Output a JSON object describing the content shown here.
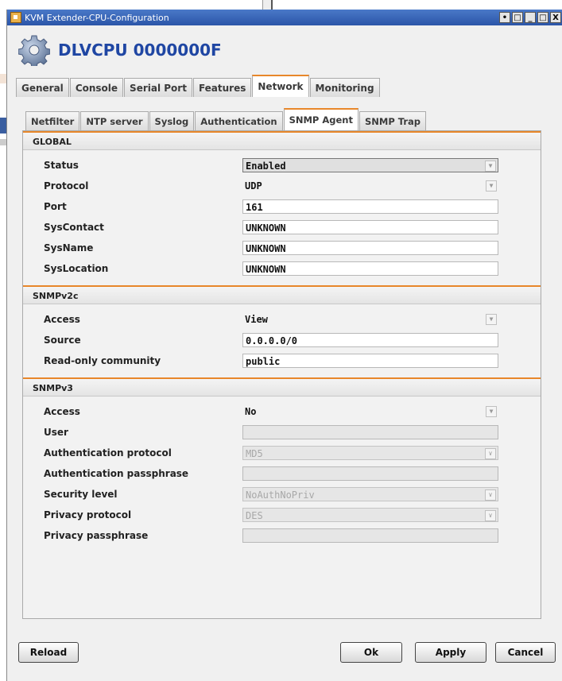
{
  "window": {
    "title": "KVM Extender-CPU-Configuration",
    "controls": [
      "•",
      "□",
      "_",
      "□",
      "X"
    ]
  },
  "header": {
    "device_title": "DLVCPU 0000000F"
  },
  "main_tabs": [
    {
      "label": "General",
      "active": false
    },
    {
      "label": "Console",
      "active": false
    },
    {
      "label": "Serial Port",
      "active": false
    },
    {
      "label": "Features",
      "active": false
    },
    {
      "label": "Network",
      "active": true
    },
    {
      "label": "Monitoring",
      "active": false
    }
  ],
  "sub_tabs": [
    {
      "label": "Netfilter",
      "active": false
    },
    {
      "label": "NTP server",
      "active": false
    },
    {
      "label": "Syslog",
      "active": false
    },
    {
      "label": "Authentication",
      "active": false
    },
    {
      "label": "SNMP Agent",
      "active": true
    },
    {
      "label": "SNMP Trap",
      "active": false
    }
  ],
  "global": {
    "heading": "GLOBAL",
    "status_label": "Status",
    "status_value": "Enabled",
    "protocol_label": "Protocol",
    "protocol_value": "UDP",
    "port_label": "Port",
    "port_value": "161",
    "syscontact_label": "SysContact",
    "syscontact_value": "UNKNOWN",
    "sysname_label": "SysName",
    "sysname_value": "UNKNOWN",
    "syslocation_label": "SysLocation",
    "syslocation_value": "UNKNOWN"
  },
  "snmpv2c": {
    "heading": "SNMPv2c",
    "access_label": "Access",
    "access_value": "View",
    "source_label": "Source",
    "source_value": "0.0.0.0/0",
    "community_label": "Read-only community",
    "community_value": "public"
  },
  "snmpv3": {
    "heading": "SNMPv3",
    "access_label": "Access",
    "access_value": "No",
    "user_label": "User",
    "user_value": "",
    "auth_protocol_label": "Authentication protocol",
    "auth_protocol_value": "MD5",
    "auth_pass_label": "Authentication passphrase",
    "auth_pass_value": "",
    "security_label": "Security level",
    "security_value": "NoAuthNoPriv",
    "privacy_protocol_label": "Privacy protocol",
    "privacy_protocol_value": "DES",
    "privacy_pass_label": "Privacy passphrase",
    "privacy_pass_value": ""
  },
  "buttons": {
    "reload": "Reload",
    "ok": "Ok",
    "apply": "Apply",
    "cancel": "Cancel"
  },
  "colors": {
    "accent": "#e8872a",
    "title_blue": "#1f46a3",
    "titlebar": "#2b55a8"
  }
}
